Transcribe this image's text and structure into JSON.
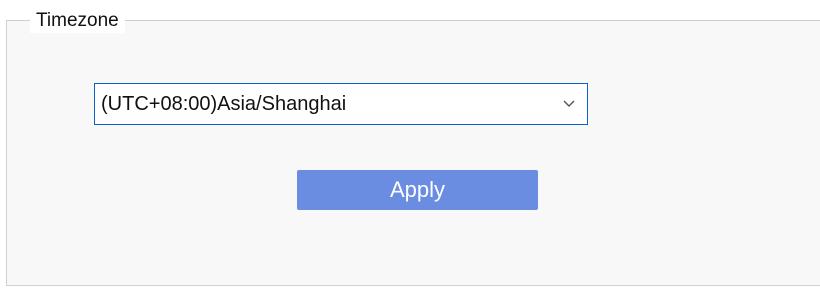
{
  "timezone_group": {
    "title": "Timezone",
    "select": {
      "selected_value": "(UTC+08:00)Asia/Shanghai",
      "chevron_icon": "chevron-down-icon"
    },
    "apply_label": "Apply"
  },
  "colors": {
    "accent_border": "#0a64c8",
    "apply_button_bg": "#6b8de1",
    "group_border": "#cfcfcf"
  }
}
